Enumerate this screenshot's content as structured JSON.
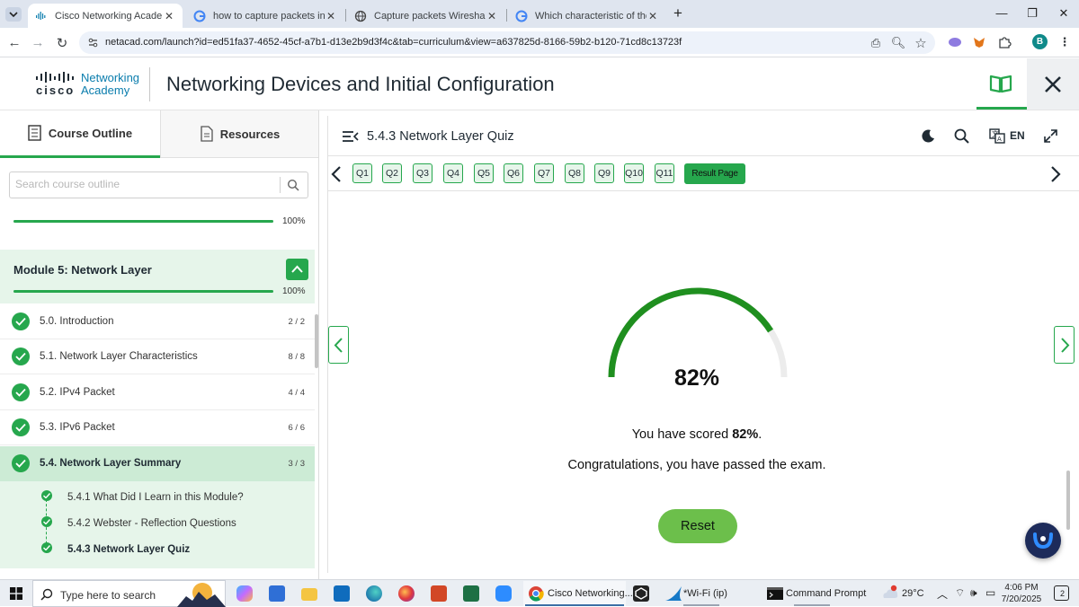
{
  "browser": {
    "tabs": [
      {
        "title": "Cisco Networking Academy: Ne",
        "active": true,
        "icon": "cisco-icon"
      },
      {
        "title": "how to capture packets in wire",
        "active": false,
        "icon": "google-icon"
      },
      {
        "title": "Capture packets Wireshark",
        "active": false,
        "icon": "globe-icon"
      },
      {
        "title": "Which characteristic of the netw",
        "active": false,
        "icon": "google-icon"
      }
    ],
    "url": "netacad.com/launch?id=ed51fa37-4652-45cf-a7b1-d13e2b9d3f4c&tab=curriculum&view=a637825d-8166-59b2-b120-71cd8c13723f",
    "profile_initial": "B"
  },
  "site": {
    "logo_word": "cisco",
    "logo_line1": "Networking",
    "logo_line2": "Academy",
    "course_title": "Networking Devices and Initial Configuration"
  },
  "sidebar": {
    "tab_outline": "Course Outline",
    "tab_resources": "Resources",
    "search_placeholder": "Search course outline",
    "overall_progress_label": "100%",
    "overall_progress": 1.0,
    "module_title": "Module 5: Network Layer",
    "module_progress_label": "100%",
    "module_progress": 1.0,
    "sections": [
      {
        "label": "5.0. Introduction",
        "count": "2 / 2"
      },
      {
        "label": "5.1. Network Layer Characteristics",
        "count": "8 / 8"
      },
      {
        "label": "5.2. IPv4 Packet",
        "count": "4 / 4"
      },
      {
        "label": "5.3. IPv6 Packet",
        "count": "6 / 6"
      },
      {
        "label": "5.4. Network Layer Summary",
        "count": "3 / 3"
      }
    ],
    "subsections": [
      {
        "label": "5.4.1 What Did I Learn in this Module?"
      },
      {
        "label": "5.4.2 Webster - Reflection Questions"
      },
      {
        "label": "5.4.3 Network Layer Quiz"
      }
    ]
  },
  "quiz": {
    "title": "5.4.3 Network Layer Quiz",
    "language": "EN",
    "questions": [
      "Q1",
      "Q2",
      "Q3",
      "Q4",
      "Q5",
      "Q6",
      "Q7",
      "Q8",
      "Q9",
      "Q10",
      "Q11"
    ],
    "result_label": "Result Page",
    "score_display": "82%",
    "score_fraction": 0.82,
    "score_prefix": "You have scored ",
    "score_value": "82%",
    "score_suffix": ".",
    "pass_message": "Congratulations, you have passed the exam.",
    "reset_label": "Reset",
    "accent_color": "#26a74d",
    "gauge_color": "#1f8f1f"
  },
  "taskbar": {
    "search_text": "Type here to search",
    "chrome_label": "Cisco Networking...",
    "wireshark_label": "*Wi-Fi (ip)",
    "cmd_label": "Command Prompt",
    "weather": "29°C",
    "time": "4:06 PM",
    "date": "7/20/2025",
    "notification_count": "2"
  }
}
